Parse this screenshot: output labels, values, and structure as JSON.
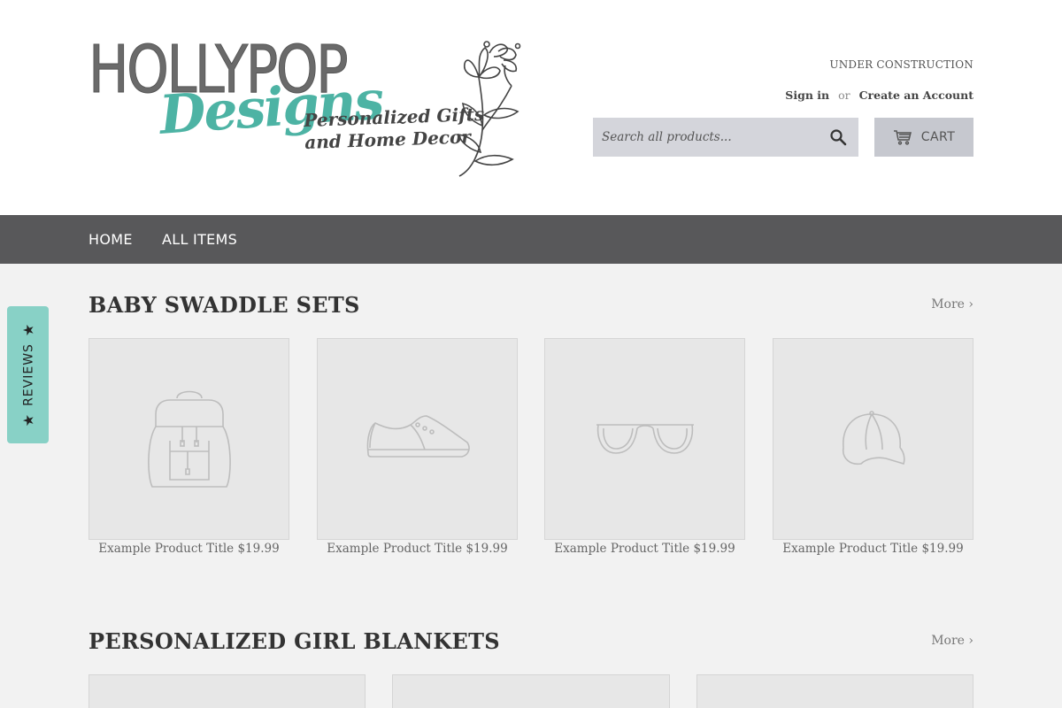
{
  "header": {
    "logo": {
      "brand_top": "HOLLYPOP",
      "brand_script": "Designs",
      "tagline_line1": "Personalized Gifts",
      "tagline_line2": "and Home Decor"
    },
    "notice": "UNDER CONSTRUCTION",
    "sign_in": "Sign in",
    "or": "or",
    "create_account": "Create an Account",
    "search": {
      "placeholder": "Search all products...",
      "icon": "search-icon"
    },
    "cart": {
      "label": "CART",
      "icon": "cart-icon"
    }
  },
  "nav": {
    "items": [
      {
        "label": "HOME"
      },
      {
        "label": "ALL ITEMS"
      }
    ]
  },
  "reviews_tab": {
    "label": "REVIEWS",
    "icon": "star-icon"
  },
  "sections": [
    {
      "title": "BABY SWADDLE SETS",
      "more": "More ›",
      "products": [
        {
          "caption": "Example Product Title $19.99",
          "icon": "backpack-icon"
        },
        {
          "caption": "Example Product Title $19.99",
          "icon": "shoe-icon"
        },
        {
          "caption": "Example Product Title $19.99",
          "icon": "sunglasses-icon"
        },
        {
          "caption": "Example Product Title $19.99",
          "icon": "cap-icon"
        }
      ]
    },
    {
      "title": "PERSONALIZED GIRL BLANKETS",
      "more": "More ›"
    }
  ],
  "colors": {
    "nav_bg": "#58585a",
    "accent_teal": "#4db3a4",
    "reviews_tab": "#88d1c6",
    "search_bg": "#d4d5db",
    "cart_bg": "#c6c8cf"
  }
}
